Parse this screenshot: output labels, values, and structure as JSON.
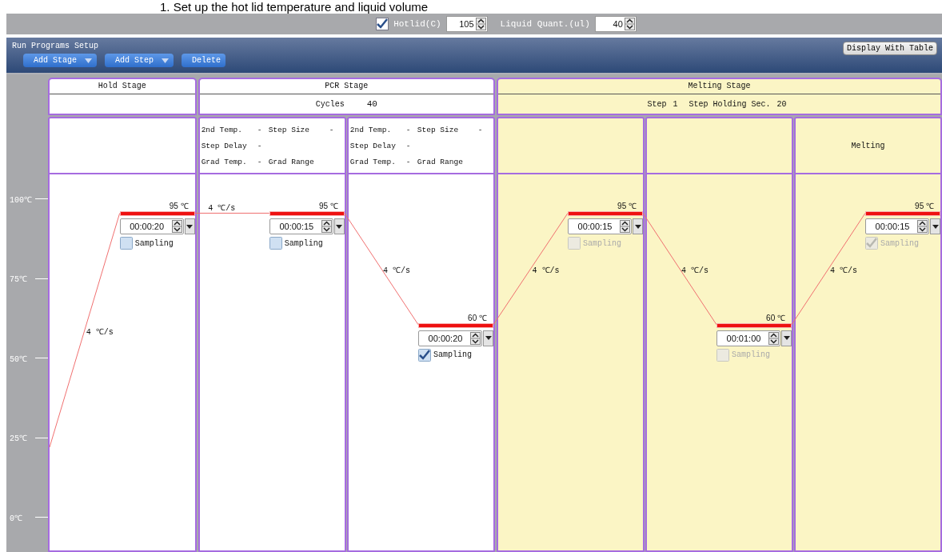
{
  "caption": "1. Set up the hot lid temperature and liquid volume",
  "toolbar": {
    "hotlid": {
      "label": "Hotlid(C)",
      "checked": true,
      "value": "105"
    },
    "liquid": {
      "label": "Liquid Quant.(ul)",
      "value": "40"
    }
  },
  "setup": {
    "title": "Run Programs Setup",
    "display_button": "Display With Table",
    "buttons": [
      {
        "label": "Add Stage",
        "kind": "dropdown"
      },
      {
        "label": "Add Step",
        "kind": "dropdown"
      },
      {
        "label": "Delete",
        "kind": "plain"
      }
    ]
  },
  "axis": {
    "ticks": [
      "100℃",
      "75℃",
      "50℃",
      "25℃",
      "0℃"
    ]
  },
  "stages": [
    {
      "title": "Hold Stage",
      "selected": false,
      "sub": {
        "kind": "empty"
      },
      "steps": [
        {
          "info": {
            "kind": "none"
          },
          "rate": "4 ℃/s",
          "temp": "95 ℃",
          "time": "00:00:20",
          "sampling": {
            "label": "Sampling",
            "checked": false,
            "disabled": false
          }
        }
      ]
    },
    {
      "title": "PCR Stage",
      "selected": false,
      "sub": {
        "kind": "cycles",
        "label": "Cycles",
        "value": "40"
      },
      "steps": [
        {
          "info": {
            "kind": "pcr",
            "second_temp_label": "2nd Temp.",
            "second_temp": "-",
            "step_size_label": "Step Size",
            "step_size": "-",
            "step_delay_label": "Step Delay",
            "step_delay": "-",
            "grad_temp_label": "Grad Temp.",
            "grad_temp": "-",
            "grad_range_label": "Grad Range"
          },
          "rate": "4 ℃/s",
          "temp": "95 ℃",
          "time": "00:00:15",
          "sampling": {
            "label": "Sampling",
            "checked": false,
            "disabled": false
          }
        },
        {
          "info": {
            "kind": "pcr",
            "second_temp_label": "2nd Temp.",
            "second_temp": "-",
            "step_size_label": "Step Size",
            "step_size": "-",
            "step_delay_label": "Step Delay",
            "step_delay": "-",
            "grad_temp_label": "Grad Temp.",
            "grad_temp": "-",
            "grad_range_label": "Grad Range"
          },
          "rate": "4 ℃/s",
          "temp": "60 ℃",
          "time": "00:00:20",
          "sampling": {
            "label": "Sampling",
            "checked": true,
            "disabled": false
          }
        }
      ]
    },
    {
      "title": "Melting Stage",
      "selected": true,
      "sub": {
        "kind": "melt",
        "step_label": "Step",
        "step_value": "1",
        "hold_label": "Step Holding Sec.",
        "hold_value": "20"
      },
      "steps": [
        {
          "info": {
            "kind": "none"
          },
          "rate": "4 ℃/s",
          "temp": "95 ℃",
          "time": "00:00:15",
          "sampling": {
            "label": "Sampling",
            "checked": false,
            "disabled": true
          }
        },
        {
          "info": {
            "kind": "none"
          },
          "rate": "4 ℃/s",
          "temp": "60 ℃",
          "time": "00:01:00",
          "sampling": {
            "label": "Sampling",
            "checked": false,
            "disabled": true
          }
        },
        {
          "info": {
            "kind": "label",
            "text": "Melting"
          },
          "rate": "4 ℃/s",
          "temp": "95 ℃",
          "time": "00:00:15",
          "sampling": {
            "label": "Sampling",
            "checked": true,
            "disabled": true
          }
        }
      ]
    }
  ]
}
